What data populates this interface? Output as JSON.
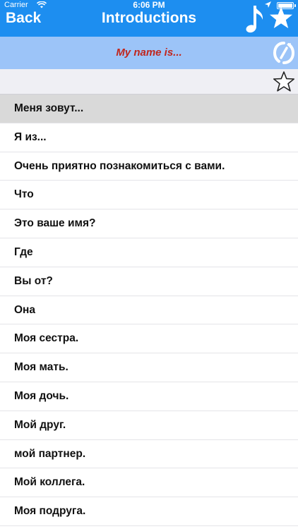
{
  "status_bar": {
    "carrier": "Carrier",
    "time": "6:06 PM"
  },
  "nav": {
    "back_label": "Back",
    "title": "Introductions",
    "color": "#1d8ef0"
  },
  "phrase_header": {
    "text": "My name is...",
    "text_color": "#c0271e",
    "background": "#9cc4f8"
  },
  "icons": {
    "music": "music-note-icon",
    "star_nav": "star-icon",
    "loop": "loop-icon",
    "favorite": "star-outline-icon"
  },
  "phrases": [
    {
      "label": "Меня зовут...",
      "selected": true
    },
    {
      "label": "Я из...",
      "selected": false
    },
    {
      "label": "Очень приятно познакомиться с вами.",
      "selected": false
    },
    {
      "label": "Что",
      "selected": false
    },
    {
      "label": "Это ваше имя?",
      "selected": false
    },
    {
      "label": "Где",
      "selected": false
    },
    {
      "label": "Вы от?",
      "selected": false
    },
    {
      "label": "Она",
      "selected": false
    },
    {
      "label": "Моя сестра.",
      "selected": false
    },
    {
      "label": "Моя мать.",
      "selected": false
    },
    {
      "label": "Моя дочь.",
      "selected": false
    },
    {
      "label": "Мой друг.",
      "selected": false
    },
    {
      "label": "мой партнер.",
      "selected": false
    },
    {
      "label": "Мой коллега.",
      "selected": false
    },
    {
      "label": "Моя подруга.",
      "selected": false
    }
  ]
}
